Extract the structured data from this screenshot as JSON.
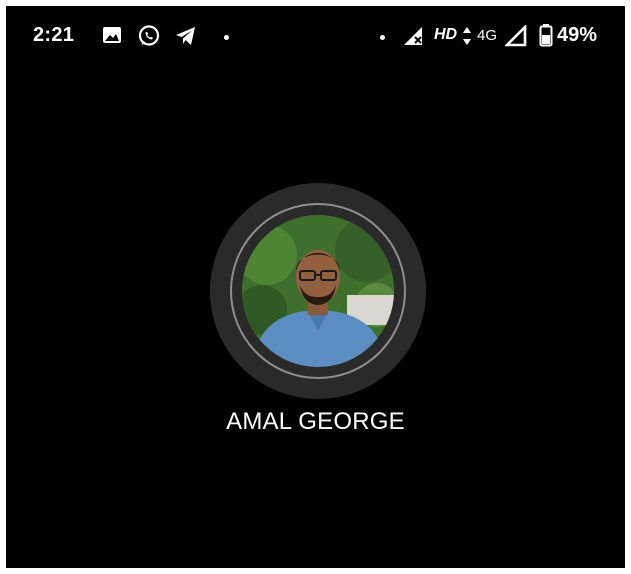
{
  "status_bar": {
    "time": "2:21",
    "icons_left": [
      "image-icon",
      "whatsapp-icon",
      "telegram-icon"
    ],
    "hd_label": "HD",
    "network_label": "4G",
    "battery_percent": "49%"
  },
  "contact": {
    "name": "AMAL GEORGE"
  },
  "colors": {
    "background": "#000000",
    "ring_outer": "#2a2a2a",
    "ring_inner": "#8e8e8e",
    "text": "#ffffff"
  }
}
